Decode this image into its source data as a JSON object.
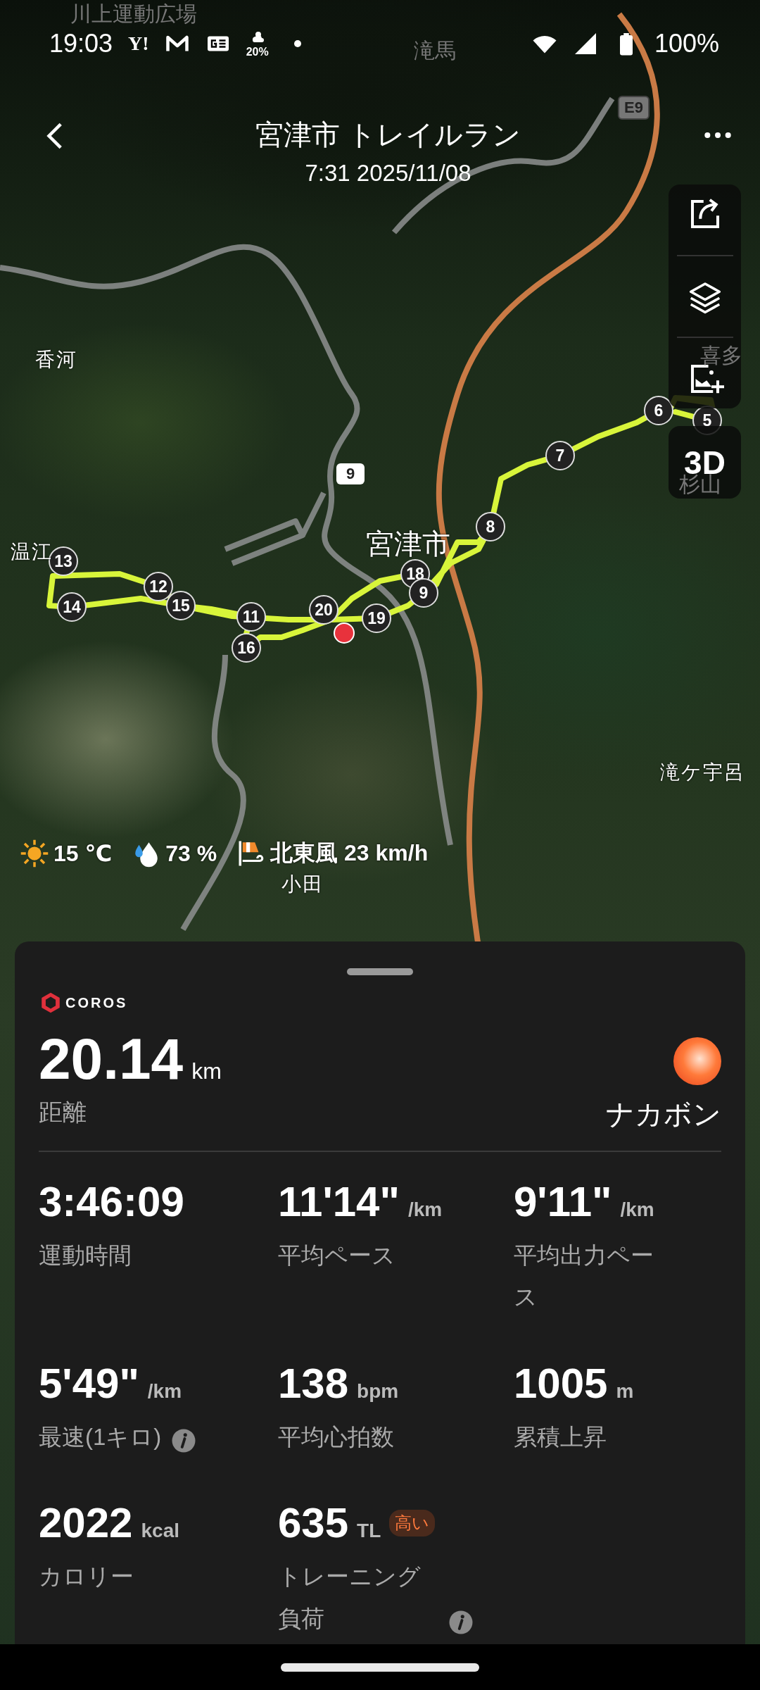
{
  "status_bar": {
    "time": "19:03",
    "notifications": [
      {
        "kind": "text",
        "label": "Y!"
      },
      {
        "kind": "mail"
      },
      {
        "kind": "news"
      },
      {
        "kind": "weather",
        "label": "20%"
      },
      {
        "kind": "dot"
      }
    ],
    "battery": "100%"
  },
  "header": {
    "title": "宮津市 トレイルラン",
    "subtitle": "7:31 2025/11/08"
  },
  "map": {
    "labels": [
      {
        "text": "川上運動広場",
        "kind": "faint"
      },
      {
        "text": "滝馬",
        "kind": "faint"
      },
      {
        "text": "香河",
        "kind": "place"
      },
      {
        "text": "喜多",
        "kind": "faint"
      },
      {
        "text": "杉山",
        "kind": "faint"
      },
      {
        "text": "温江",
        "kind": "place"
      },
      {
        "text": "宮津市",
        "kind": "city"
      },
      {
        "text": "滝ケ宇呂",
        "kind": "place"
      },
      {
        "text": "小田",
        "kind": "place"
      }
    ],
    "road_badges": [
      {
        "text": "E9",
        "kind": "highway"
      },
      {
        "text": "9",
        "kind": "route"
      }
    ],
    "markers": [
      {
        "label": "5"
      },
      {
        "label": "6"
      },
      {
        "label": "7"
      },
      {
        "label": "8"
      },
      {
        "label": "13"
      },
      {
        "label": "12"
      },
      {
        "label": "14"
      },
      {
        "label": "15"
      },
      {
        "label": "11"
      },
      {
        "label": "16"
      },
      {
        "label": "18"
      },
      {
        "label": "9"
      },
      {
        "label": "20"
      },
      {
        "label": "19"
      }
    ],
    "view_button": "3D"
  },
  "weather": [
    {
      "kind": "temperature",
      "text": "15 ℃"
    },
    {
      "kind": "humidity",
      "text": "73 %"
    },
    {
      "kind": "wind",
      "text": "北東風 23 km/h"
    }
  ],
  "summary": {
    "brand": "COROS",
    "distance": {
      "value": "20.14",
      "unit": "km",
      "label": "距離"
    },
    "user": {
      "name": "ナカボン"
    }
  },
  "stats": [
    {
      "value": "3:46:09",
      "label": "運動時間",
      "info": false
    },
    {
      "value": "11'14\"",
      "unit": "/km",
      "label": "平均ペース",
      "info": false
    },
    {
      "value": "9'11\"",
      "unit": "/km",
      "label": "平均出力ペース",
      "info": false
    },
    {
      "value": "5'49\"",
      "unit": "/km",
      "label": "最速(1キロ)",
      "info": true
    },
    {
      "value": "138",
      "unit": "bpm",
      "label": "平均心拍数",
      "info": false
    },
    {
      "value": "1005",
      "unit": "m",
      "label": "累積上昇",
      "info": false
    },
    {
      "value": "2022",
      "unit": "kcal",
      "label": "カロリー",
      "info": false
    },
    {
      "value": "635",
      "unit": "TL",
      "badge": "高い",
      "label": "トレーニング負荷",
      "info": true
    }
  ]
}
